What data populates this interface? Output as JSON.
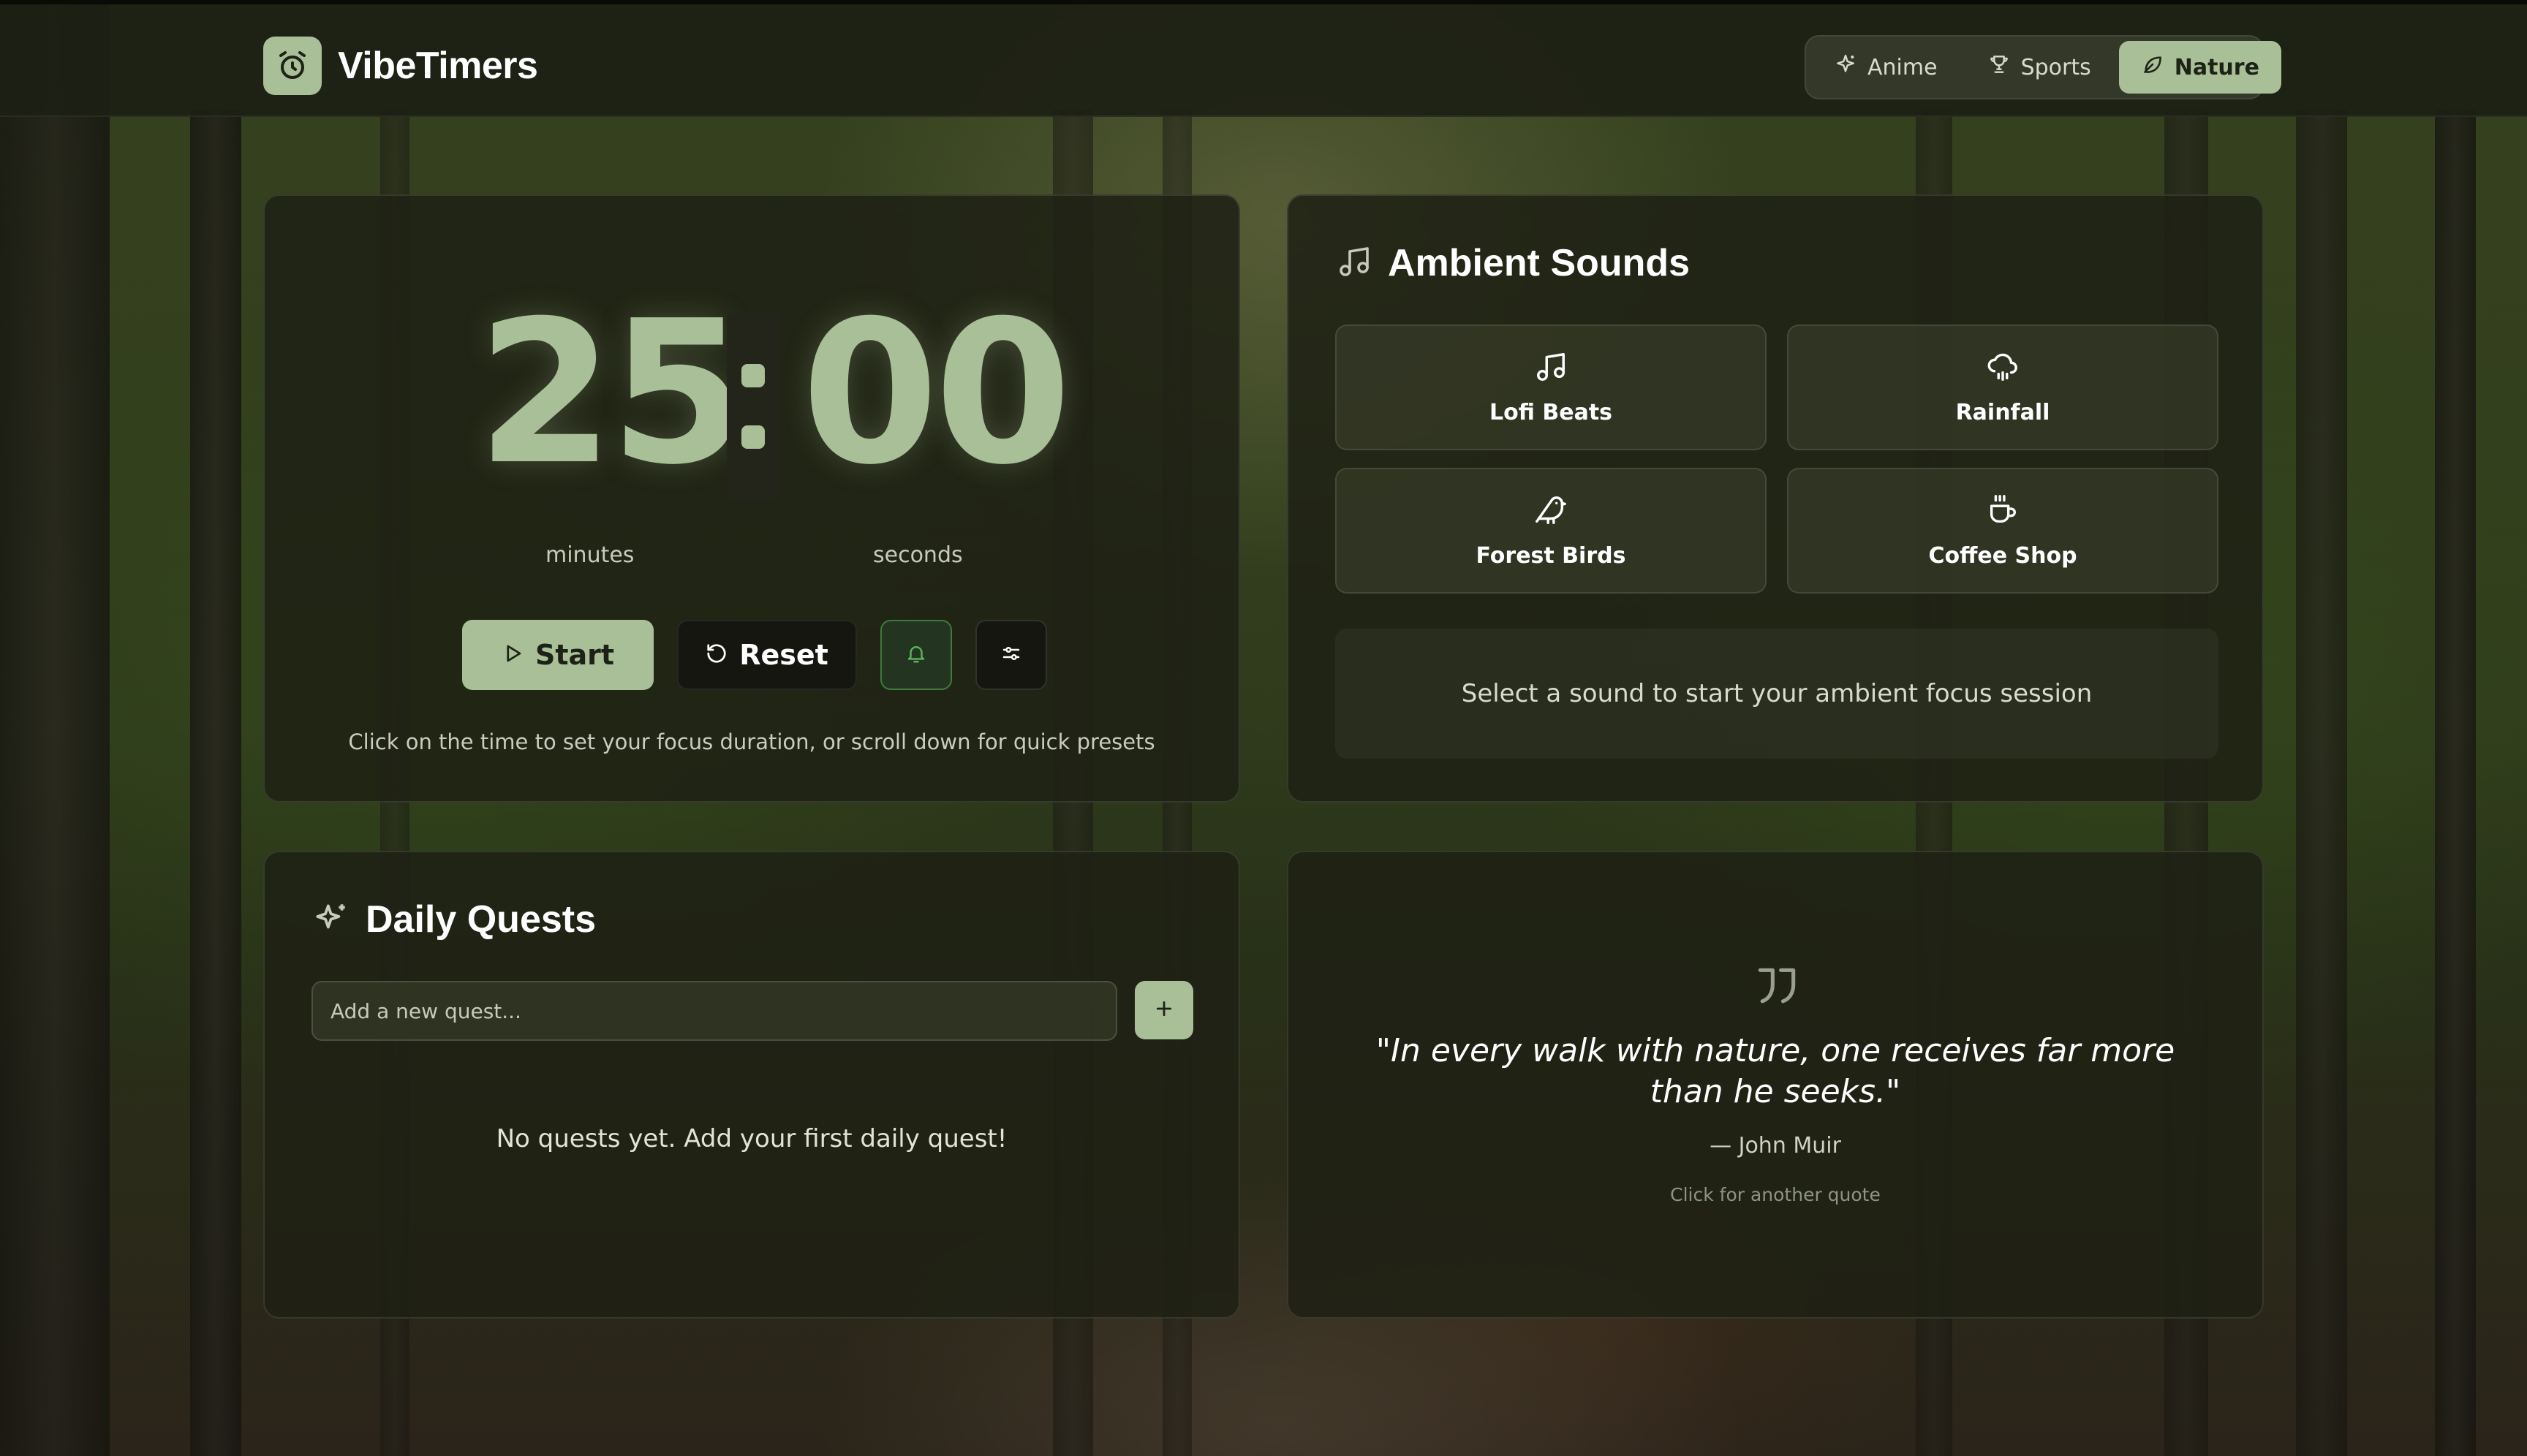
{
  "app": {
    "name": "VibeTimers"
  },
  "themes": [
    {
      "label": "Anime",
      "icon": "sparkle-icon",
      "active": false
    },
    {
      "label": "Sports",
      "icon": "trophy-icon",
      "active": false
    },
    {
      "label": "Nature",
      "icon": "leaf-icon",
      "active": true
    }
  ],
  "timer": {
    "minutes": "25",
    "seconds": "00",
    "minutes_label": "minutes",
    "seconds_label": "seconds",
    "start_label": "Start",
    "reset_label": "Reset",
    "hint": "Click on the time to set your focus duration, or scroll down for quick presets"
  },
  "ambient": {
    "title": "Ambient Sounds",
    "sounds": [
      {
        "label": "Lofi Beats",
        "icon": "music-note-icon"
      },
      {
        "label": "Rainfall",
        "icon": "cloud-rain-icon"
      },
      {
        "label": "Forest Birds",
        "icon": "bird-icon"
      },
      {
        "label": "Coffee Shop",
        "icon": "coffee-cup-icon"
      }
    ],
    "status": "Select a sound to start your ambient focus session"
  },
  "quests": {
    "title": "Daily Quests",
    "input_placeholder": "Add a new quest...",
    "input_value": "",
    "add_label": "+",
    "empty_text": "No quests yet. Add your first daily quest!"
  },
  "quote": {
    "text": "\"In every walk with nature, one receives far more than he seeks.\"",
    "author": "— John Muir",
    "next_hint": "Click for another quote"
  },
  "colors": {
    "accent": "#a9bf98",
    "panel": "#1e2114",
    "bell_active": "#3f7a3d"
  }
}
